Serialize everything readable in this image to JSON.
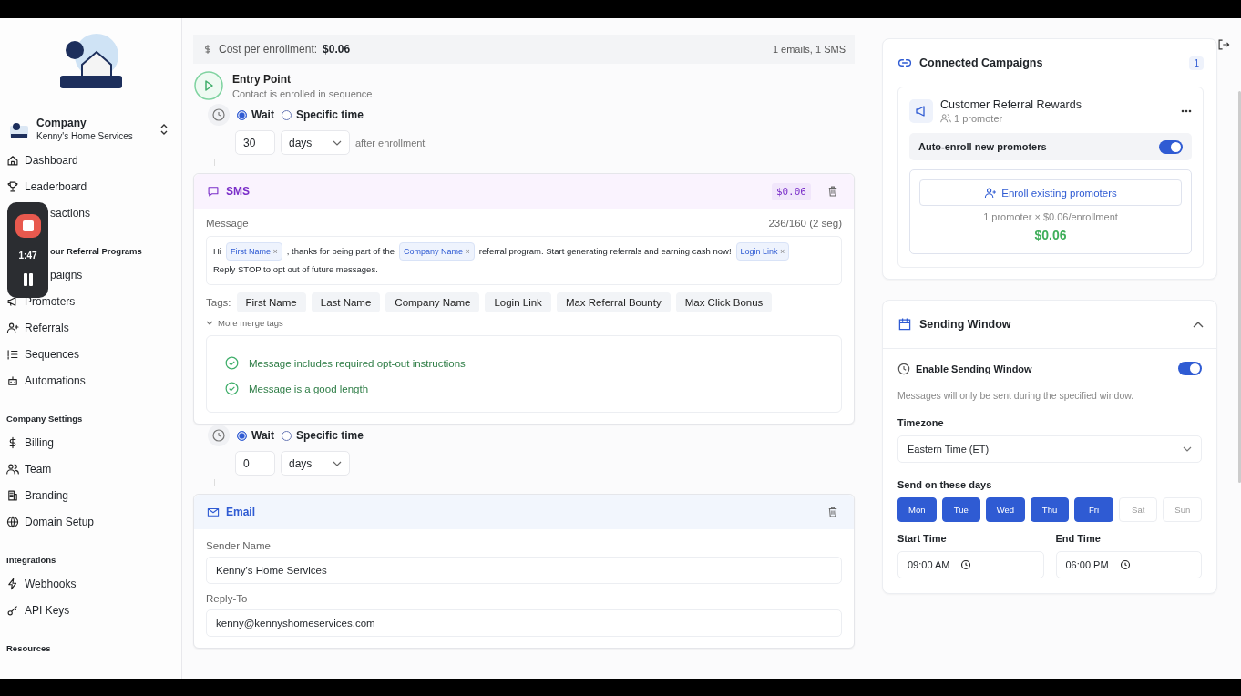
{
  "sidebar": {
    "company": {
      "label": "Company",
      "name": "Kenny's Home Services"
    },
    "groups": [
      {
        "items": [
          {
            "label": "Dashboard",
            "kind": "home"
          },
          {
            "label": "Leaderboard",
            "kind": "trophy"
          },
          {
            "label": "sactions",
            "clipped": true
          }
        ]
      },
      {
        "title": "our Referral Programs",
        "clipped": true,
        "items": [
          {
            "label": "paigns",
            "clipped": true
          },
          {
            "label": "Promoters",
            "kind": "megaphone"
          },
          {
            "label": "Referrals",
            "kind": "userplus"
          },
          {
            "label": "Sequences",
            "kind": "listnum"
          },
          {
            "label": "Automations",
            "kind": "bot"
          }
        ]
      },
      {
        "title": "Company Settings",
        "items": [
          {
            "label": "Billing",
            "kind": "dollar"
          },
          {
            "label": "Team",
            "kind": "users"
          },
          {
            "label": "Branding",
            "kind": "building"
          },
          {
            "label": "Domain Setup",
            "kind": "globe"
          }
        ]
      },
      {
        "title": "Integrations",
        "items": [
          {
            "label": "Webhooks",
            "kind": "bolt"
          },
          {
            "label": "API Keys",
            "kind": "key"
          }
        ]
      },
      {
        "title": "Resources"
      }
    ]
  },
  "recorder": {
    "time": "1:47"
  },
  "cost_bar": {
    "label": "Cost per enrollment:",
    "value": "$0.06",
    "summary": "1 emails, 1 SMS"
  },
  "entry": {
    "title": "Entry Point",
    "subtitle": "Contact is enrolled in sequence"
  },
  "steps": [
    {
      "kind": "wait",
      "options": [
        {
          "label": "Wait",
          "selected": true
        },
        {
          "label": "Specific time",
          "selected": false
        }
      ],
      "amount": "30",
      "unit": "days",
      "suffix": "after enrollment"
    },
    {
      "kind": "sms",
      "title": "SMS",
      "cost": "$0.06",
      "message_label": "Message",
      "count": "236/160 (2 seg)",
      "message": [
        {
          "kind": "text",
          "text": "Hi"
        },
        {
          "kind": "tag",
          "text": "First Name",
          "remove": "×"
        },
        {
          "kind": "text",
          "text": ", thanks for being part of the"
        },
        {
          "kind": "tag",
          "text": "Company Name",
          "remove": "×"
        },
        {
          "kind": "text",
          "text": "referral program. Start generating referrals and earning cash now!"
        },
        {
          "kind": "tag",
          "text": "Login Link",
          "remove": "×"
        },
        {
          "kind": "text",
          "text": "Reply STOP to opt out of future messages."
        }
      ],
      "tags_label": "Tags:",
      "tags": [
        "First Name",
        "Last Name",
        "Company Name",
        "Login Link",
        "Max Referral Bounty",
        "Max Click Bonus"
      ],
      "more": "More merge tags",
      "checks": [
        "Message includes required opt-out instructions",
        "Message is a good length"
      ]
    },
    {
      "kind": "wait",
      "options": [
        {
          "label": "Wait",
          "selected": true
        },
        {
          "label": "Specific time",
          "selected": false
        }
      ],
      "amount": "0",
      "unit": "days"
    },
    {
      "kind": "email",
      "title": "Email",
      "fields": [
        {
          "label": "Sender Name",
          "value": "Kenny's Home Services"
        },
        {
          "label": "Reply-To",
          "value": "kenny@kennyshomeservices.com"
        }
      ]
    }
  ],
  "connected": {
    "title": "Connected Campaigns",
    "count": "1",
    "campaign": {
      "name": "Customer Referral Rewards",
      "promoters": "1 promoter",
      "auto_enroll": {
        "label": "Auto-enroll new promoters",
        "on": true
      },
      "enroll_button": "Enroll existing promoters",
      "calc": "1 promoter × $0.06/enrollment",
      "total": "$0.06"
    }
  },
  "sending_window": {
    "title": "Sending Window",
    "expanded": true,
    "enable": {
      "label": "Enable Sending Window",
      "on": true
    },
    "note": "Messages will only be sent during the specified window.",
    "timezone_label": "Timezone",
    "timezone": "Eastern Time (ET)",
    "days_label": "Send on these days",
    "days": [
      {
        "label": "Mon",
        "selected": true
      },
      {
        "label": "Tue",
        "selected": true
      },
      {
        "label": "Wed",
        "selected": true
      },
      {
        "label": "Thu",
        "selected": true
      },
      {
        "label": "Fri",
        "selected": true
      },
      {
        "label": "Sat",
        "selected": false
      },
      {
        "label": "Sun",
        "selected": false
      }
    ],
    "start_label": "Start Time",
    "start": "09:00 AM",
    "end_label": "End Time",
    "end": "06:00 PM"
  }
}
